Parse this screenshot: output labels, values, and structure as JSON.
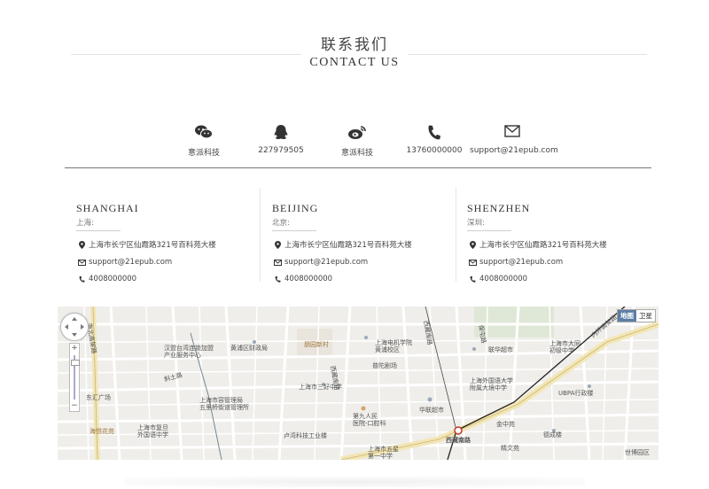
{
  "header": {
    "title_zh": "联系我们",
    "title_en": "CONTACT US"
  },
  "contacts": [
    {
      "icon": "wechat-icon",
      "label": "意派科技"
    },
    {
      "icon": "qq-icon",
      "label": "227979505"
    },
    {
      "icon": "weibo-icon",
      "label": "意派科技"
    },
    {
      "icon": "phone-icon",
      "label": "13760000000"
    },
    {
      "icon": "mail-icon",
      "label": "support@21epub.com"
    }
  ],
  "offices": [
    {
      "name_en": "SHANGHAI",
      "name_zh": "上海:",
      "address": "上海市长宁区仙霞路321号百科苑大楼",
      "email": "support@21epub.com",
      "phone": "4008000000"
    },
    {
      "name_en": "BEIJING",
      "name_zh": "北京:",
      "address": "上海市长宁区仙霞路321号百科苑大楼",
      "email": "support@21epub.com",
      "phone": "4008000000"
    },
    {
      "name_en": "SHENZHEN",
      "name_zh": "深圳:",
      "address": "上海市长宁区仙霞路321号百科苑大楼",
      "email": "support@21epub.com",
      "phone": "4008000000"
    }
  ],
  "map": {
    "toggle": {
      "map": "地图",
      "satellite": "卫星"
    },
    "labels": [
      "南北高架路",
      "汉盟台湾连锁加盟\n产业服务中心",
      "黄浦区财政局",
      "朋园新村",
      "上海电机学院\n黄浦校区",
      "西藏南路",
      "保屯路",
      "上海市大同\n初级中学",
      "联华超市",
      "内环高架路",
      "斜土路",
      "西藏南路",
      "上海市三好中学",
      "普陀剧场",
      "上海外国语大学\n附属大境中学",
      "UBPA行政楼",
      "东汇广场",
      "上海市容管理局\n五里桥街道管理所",
      "上海市复旦\n外国语中学",
      "第九人民\n医院-口腔科",
      "华联超市",
      "卢湾科技工业楼",
      "上海市五星\n第一中学",
      "西藏南路",
      "金中苑",
      "德成楼",
      "精文苑",
      "海悦花苑",
      "世博园区"
    ]
  },
  "colors": {
    "accent": "#333333",
    "rule": "#777777",
    "map_bg": "#f1f0ec",
    "road": "#ffffff",
    "highway": "#e8d9a8"
  }
}
